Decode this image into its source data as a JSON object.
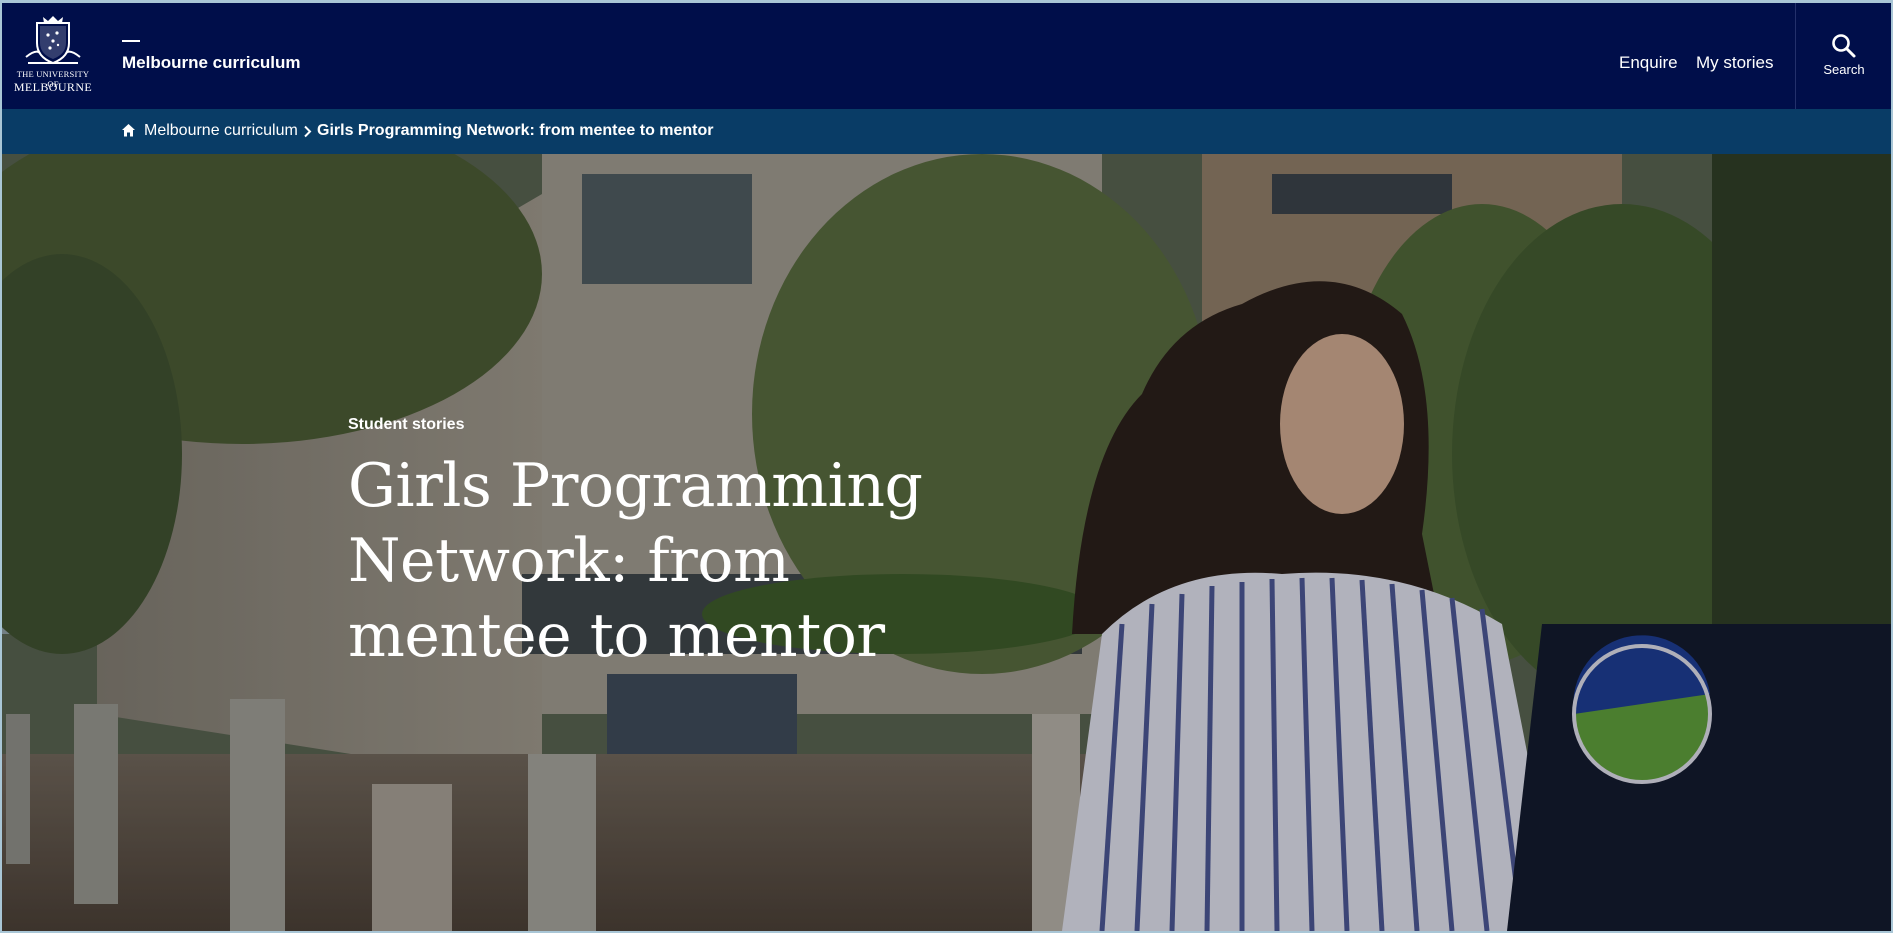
{
  "header": {
    "logo": {
      "line1": "THE UNIVERSITY OF",
      "line2": "MELBOURNE",
      "icon": "crest-icon"
    },
    "site_title": "Melbourne curriculum",
    "nav": [
      {
        "label": "Enquire"
      },
      {
        "label": "My stories"
      }
    ],
    "search": {
      "label": "Search",
      "icon": "search-icon"
    }
  },
  "breadcrumb": {
    "home_icon": "home-icon",
    "items": [
      {
        "label": "Melbourne curriculum"
      },
      {
        "label": "Girls Programming Network: from mentee to mentor"
      }
    ]
  },
  "hero": {
    "eyebrow": "Student stories",
    "title": "Girls Programming Network: from mentee to mentor"
  },
  "colors": {
    "header_bg": "#000e4a",
    "breadcrumb_bg": "#093c66",
    "text": "#ffffff"
  }
}
